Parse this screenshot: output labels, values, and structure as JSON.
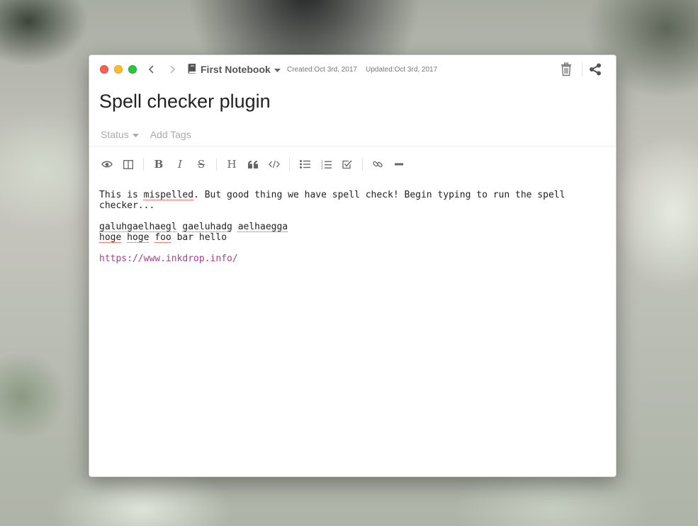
{
  "window": {
    "notebook": "First Notebook",
    "created": "Created:Oct 3rd, 2017",
    "updated": "Updated:Oct 3rd, 2017"
  },
  "note": {
    "title": "Spell checker plugin",
    "status_label": "Status",
    "tags_placeholder": "Add Tags"
  },
  "toolbar": {
    "icons": [
      "eye-icon",
      "columns-icon",
      "bold-icon",
      "italic-icon",
      "strikethrough-icon",
      "heading-icon",
      "quote-icon",
      "code-icon",
      "bullet-list-icon",
      "numbered-list-icon",
      "task-list-icon",
      "link-icon",
      "horizontal-rule-icon"
    ]
  },
  "editor": {
    "line1": {
      "w1": "This is ",
      "w2": "mispelled",
      "w3": ". But good thing we have spell check! Begin typing to run the spell checker..."
    },
    "line2": {
      "w1": "galuhgaelhaegl",
      "w2": "gaeluhadg",
      "w3": "aelhaegga"
    },
    "line3": {
      "w1": "hoge",
      "w2": "hoge",
      "w3": "foo",
      "w4": " bar hello"
    },
    "link": "https://www.inkdrop.info/"
  },
  "colors": {
    "close": "#fc5f57",
    "minimize": "#fdbc2e",
    "zoom": "#28c840",
    "link": "#a83d92",
    "spell_underline": "#dd3333"
  }
}
